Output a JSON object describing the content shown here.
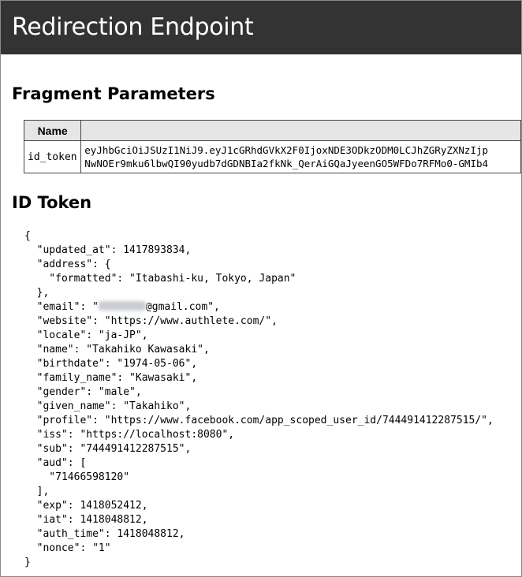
{
  "header": {
    "title": "Redirection Endpoint"
  },
  "fragment_section": {
    "heading": "Fragment Parameters",
    "table": {
      "col_name": "Name",
      "col_value": "",
      "rows": [
        {
          "name": "id_token",
          "value_line1": "eyJhbGciOiJSUzI1NiJ9.eyJ1cGRhdGVkX2F0IjoxNDE3ODkzODM0LCJhZGRyZXNzIjp",
          "value_line2": "NwNOEr9mku6lbwQI90yudb7dGDNBIa2fkNk_QerAiGQaJyeenGO5WFDo7RFMo0-GMIb4"
        }
      ]
    }
  },
  "id_token_section": {
    "heading": "ID Token",
    "lines": [
      "{",
      "  \"updated_at\": 1417893834,",
      "  \"address\": {",
      "    \"formatted\": \"Itabashi-ku, Tokyo, Japan\"",
      "  },",
      "  \"email\": \"",
      "  \"website\": \"https://www.authlete.com/\",",
      "  \"locale\": \"ja-JP\",",
      "  \"name\": \"Takahiko Kawasaki\",",
      "  \"birthdate\": \"1974-05-06\",",
      "  \"family_name\": \"Kawasaki\",",
      "  \"gender\": \"male\",",
      "  \"given_name\": \"Takahiko\",",
      "  \"profile\": \"https://www.facebook.com/app_scoped_user_id/744491412287515/\",",
      "  \"iss\": \"https://localhost:8080\",",
      "  \"sub\": \"744491412287515\",",
      "  \"aud\": [",
      "    \"71466598120\"",
      "  ],",
      "  \"exp\": 1418052412,",
      "  \"iat\": 1418048812,",
      "  \"auth_time\": 1418048812,",
      "  \"nonce\": \"1\"",
      "}"
    ],
    "email_suffix": "@gmail.com\","
  }
}
